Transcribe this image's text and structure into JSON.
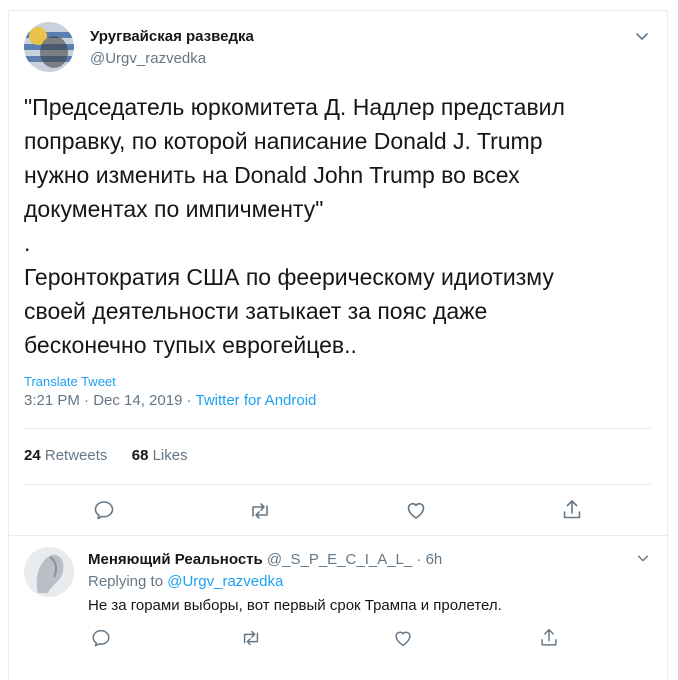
{
  "tweet": {
    "author_name": "Уругвайская разведка",
    "author_handle": "@Urgv_razvedka",
    "text": "\"Председатель юркомитета Д. Надлер представил\nпоправку, по которой написание Donald J. Trump\nнужно изменить на Donald John Trump во всех\nдокументах по импичменту\"\n.\nГеронтократия США по феерическому идиотизму\nсвоей деятельности затыкает за пояс даже\nбесконечно тупых еврогейцев..",
    "translate_label": "Translate Tweet",
    "timestamp": "3:21 PM · Dec 14, 2019 ·",
    "source": "Twitter for Android",
    "retweets_count": "24",
    "retweets_label": "Retweets",
    "likes_count": "68",
    "likes_label": "Likes"
  },
  "reply": {
    "author_name": "Меняющий Реальность",
    "author_handle": "@_S_P_E_C_I_A_L_",
    "time": "· 6h",
    "replying_label": "Replying to",
    "replying_handle": "@Urgv_razvedka",
    "text": "Не за горами выборы, вот первый срок Трампа и пролетел."
  },
  "colors": {
    "accent": "#1da1f2",
    "muted": "#657786",
    "border": "#e6ecf0"
  },
  "icons": [
    "chevron-down-icon",
    "reply-icon",
    "retweet-icon",
    "like-icon",
    "share-icon"
  ]
}
